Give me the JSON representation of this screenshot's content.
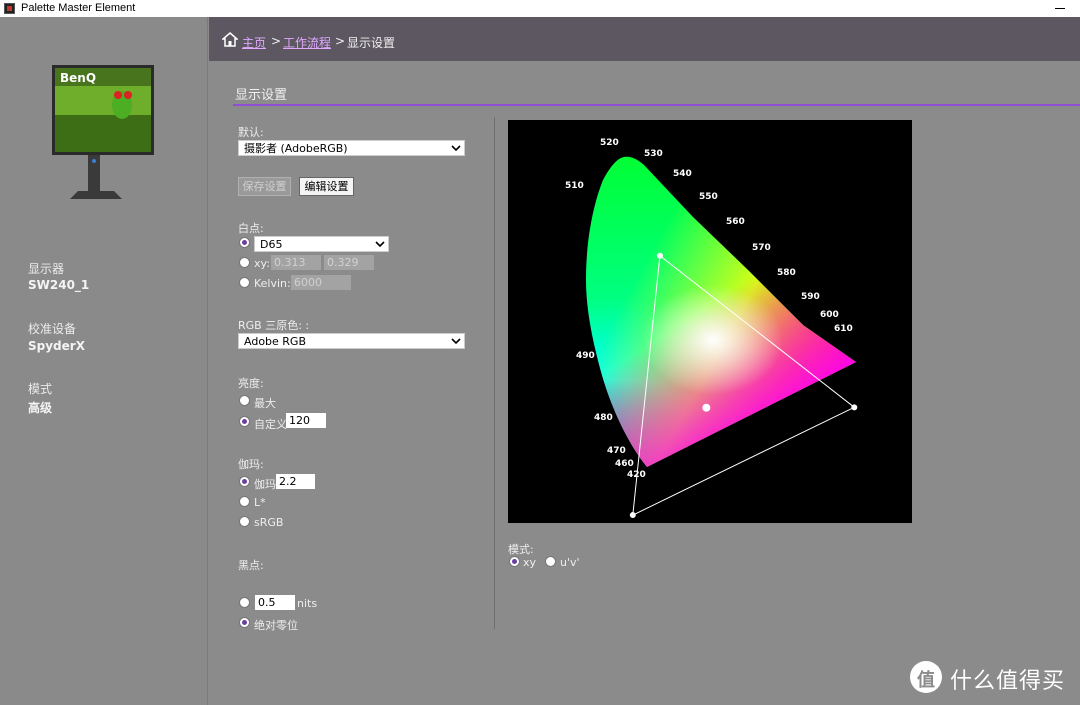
{
  "window": {
    "title": "Palette Master Element"
  },
  "sidebar": {
    "monitor_brand": "BenQ",
    "info": [
      {
        "label": "显示器",
        "value": "SW240_1"
      },
      {
        "label": "校准设备",
        "value": "SpyderX"
      },
      {
        "label": "模式",
        "value": "高级"
      }
    ]
  },
  "breadcrumb": {
    "home": "主页",
    "sep1": ">",
    "workflow": "工作流程",
    "sep2": ">",
    "current": "显示设置"
  },
  "page": {
    "title": "显示设置"
  },
  "settings": {
    "default_label": "默认:",
    "default_value": "摄影者 (AdobeRGB)",
    "save_button": "保存设置",
    "edit_button": "编辑设置",
    "whitepoint_label": "白点:",
    "whitepoint_value": "D65",
    "xy_label": "xy:",
    "x_value": "0.313",
    "y_value": "0.329",
    "kelvin_label": "Kelvin:",
    "kelvin_value": "6000",
    "rgb_label": "RGB 三原色: :",
    "rgb_value": "Adobe RGB",
    "brightness_label": "亮度:",
    "brightness_max": "最大",
    "brightness_custom": "自定义",
    "brightness_value": "120",
    "gamma_label": "伽玛:",
    "gamma_option": "伽玛",
    "gamma_value": "2.2",
    "gamma_lstar": "L*",
    "gamma_srgb": "sRGB",
    "blackpoint_label": "黑点:",
    "blackpoint_value": "0.5",
    "blackpoint_unit": "nits",
    "blackpoint_absolute": "绝对零位"
  },
  "chart_mode": {
    "label": "模式:",
    "xy": "xy",
    "uv": "u'v'"
  },
  "chart_data": {
    "type": "scatter",
    "title": "",
    "wavelength_labels": [
      "420",
      "460",
      "470",
      "480",
      "490",
      "510",
      "520",
      "530",
      "540",
      "550",
      "560",
      "570",
      "580",
      "590",
      "600",
      "610"
    ],
    "gamut_triangle": [
      {
        "name": "red",
        "x": 0.64,
        "y": 0.33
      },
      {
        "name": "green",
        "x": 0.21,
        "y": 0.71
      },
      {
        "name": "blue",
        "x": 0.15,
        "y": 0.06
      }
    ],
    "white_point": {
      "x": 0.3127,
      "y": 0.329
    }
  },
  "watermark": {
    "icon": "值",
    "text": "什么值得买"
  }
}
